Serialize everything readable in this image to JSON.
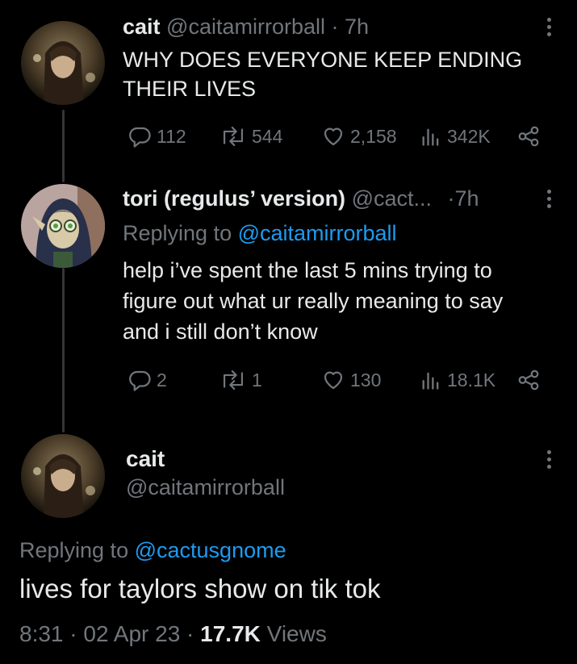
{
  "tweets": [
    {
      "name": "cait",
      "handle": "@caitamirrorball",
      "separator": "·",
      "time": "7h",
      "text_line1": "WHY DOES EVERYONE KEEP ENDING",
      "text_line2": "THEIR LIVES",
      "replies": "112",
      "retweets": "544",
      "likes": "2,158",
      "views": "342K"
    },
    {
      "name": "tori (regulus’ version)",
      "handle": "@cact...",
      "separator": "·",
      "time": "7h",
      "replying_prefix": "Replying to",
      "replying_handle": "@caitamirrorball",
      "text_line1": "help i’ve spent the last 5 mins trying to",
      "text_line2": "figure out what ur really meaning to say",
      "text_line3": "and i still don’t know",
      "replies": "2",
      "retweets": "1",
      "likes": "130",
      "views": "18.1K"
    }
  ],
  "main_tweet": {
    "name": "cait",
    "handle": "@caitamirrorball",
    "replying_prefix": "Replying to",
    "replying_handle": "@cactusgnome",
    "text": "lives for taylors show on tik tok",
    "time": "8:31",
    "separator": "·",
    "date": "02 Apr 23",
    "views_count": "17.7K",
    "views_label": "Views"
  },
  "colors": {
    "background": "#000000",
    "text": "#e7e9ea",
    "muted": "#71767b",
    "link": "#1d9bf0",
    "thread_line": "#333639"
  },
  "icons": [
    "more-icon",
    "reply-icon",
    "retweet-icon",
    "like-icon",
    "views-icon",
    "share-icon"
  ]
}
